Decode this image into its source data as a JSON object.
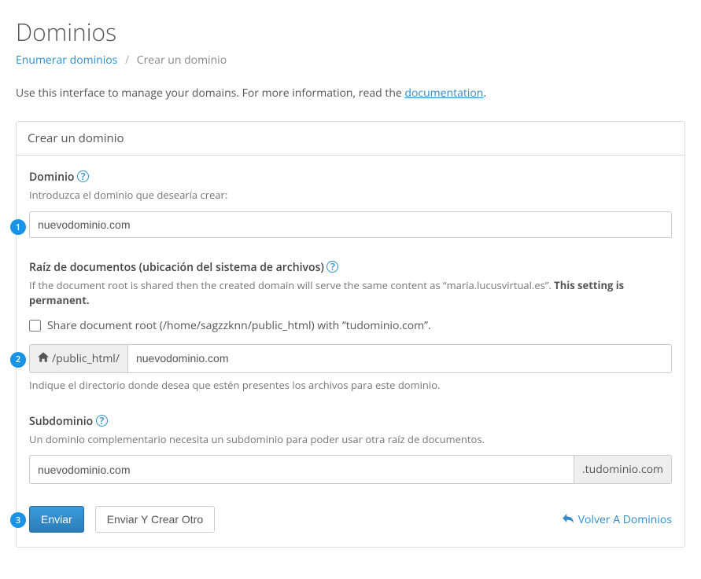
{
  "page": {
    "title": "Dominios",
    "intro_prefix": "Use this interface to manage your domains. For more information, read the ",
    "intro_link": "documentation",
    "intro_suffix": "."
  },
  "breadcrumb": {
    "root": "Enumerar dominios",
    "sep": "/",
    "current": "Crear un dominio"
  },
  "panel": {
    "title": "Crear un dominio"
  },
  "domain": {
    "label": "Dominio",
    "helper": "Introduzca el dominio que desearía crear:",
    "value": "nuevodominio.com"
  },
  "docroot": {
    "label": "Raíz de documentos (ubicación del sistema de archivos)",
    "helper_prefix": "If the document root is shared then the created domain will serve the same content as “maria.lucusvirtual.es”. ",
    "helper_strong": "This setting is permanent.",
    "share_label": "Share document root (/home/sagzzknn/public_html) with “tudominio.com”.",
    "share_checked": false,
    "prefix": "/public_html/",
    "value": "nuevodominio.com",
    "post_text": "Indique el directorio donde desea que estén presentes los archivos para este dominio."
  },
  "subdomain": {
    "label": "Subdominio",
    "helper": "Un dominio complementario necesita un subdominio para poder usar otra raíz de documentos.",
    "value": "nuevodominio.com",
    "suffix": ".tudominio.com"
  },
  "actions": {
    "submit": "Enviar",
    "submit_another": "Enviar Y Crear Otro",
    "back": "Volver A Dominios"
  },
  "steps": {
    "one": "1",
    "two": "2",
    "three": "3"
  }
}
